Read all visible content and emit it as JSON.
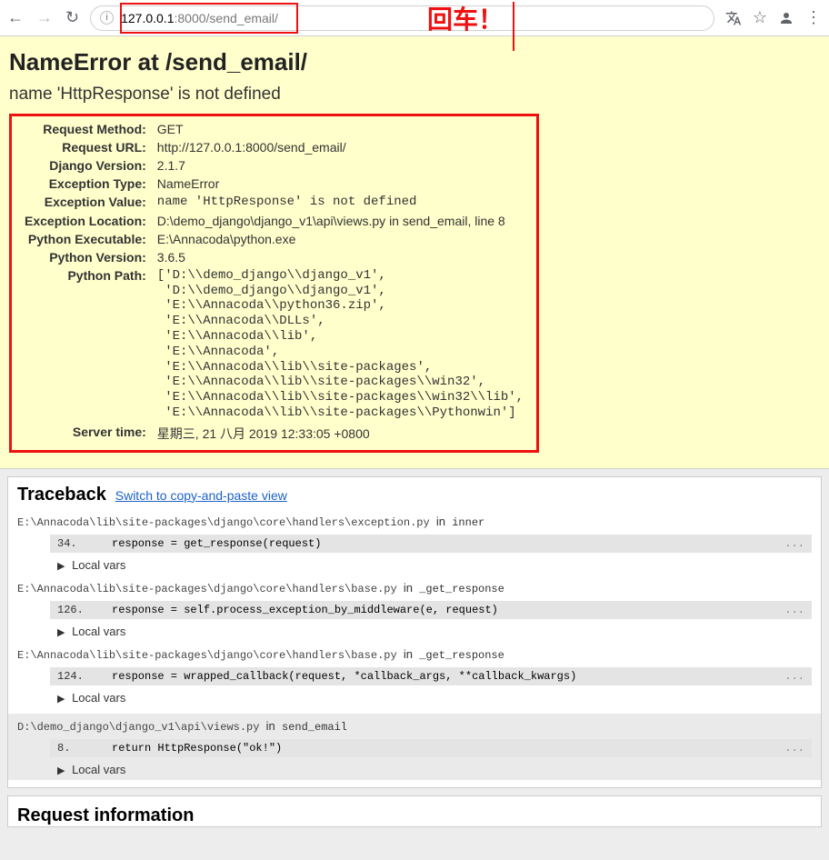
{
  "browser": {
    "url_prefix": "127.0.0.1",
    "url_port": ":8000",
    "url_path": "/send_email/"
  },
  "annotation": "回车！",
  "error": {
    "title": "NameError at /send_email/",
    "subtitle": "name 'HttpResponse' is not defined",
    "rows": {
      "request_method_label": "Request Method:",
      "request_method": "GET",
      "request_url_label": "Request URL:",
      "request_url": "http://127.0.0.1:8000/send_email/",
      "django_version_label": "Django Version:",
      "django_version": "2.1.7",
      "exception_type_label": "Exception Type:",
      "exception_type": "NameError",
      "exception_value_label": "Exception Value:",
      "exception_value": "name 'HttpResponse' is not defined",
      "exception_location_label": "Exception Location:",
      "exception_location": "D:\\demo_django\\django_v1\\api\\views.py in send_email, line 8",
      "python_executable_label": "Python Executable:",
      "python_executable": "E:\\Annacoda\\python.exe",
      "python_version_label": "Python Version:",
      "python_version": "3.6.5",
      "python_path_label": "Python Path:",
      "python_path": "['D:\\\\demo_django\\\\django_v1',\n 'D:\\\\demo_django\\\\django_v1',\n 'E:\\\\Annacoda\\\\python36.zip',\n 'E:\\\\Annacoda\\\\DLLs',\n 'E:\\\\Annacoda\\\\lib',\n 'E:\\\\Annacoda',\n 'E:\\\\Annacoda\\\\lib\\\\site-packages',\n 'E:\\\\Annacoda\\\\lib\\\\site-packages\\\\win32',\n 'E:\\\\Annacoda\\\\lib\\\\site-packages\\\\win32\\\\lib',\n 'E:\\\\Annacoda\\\\lib\\\\site-packages\\\\Pythonwin']",
      "server_time_label": "Server time:",
      "server_time": "星期三, 21 八月 2019 12:33:05 +0800"
    }
  },
  "traceback": {
    "heading": "Traceback",
    "switch": "Switch to copy-and-paste view",
    "local_vars": "Local vars",
    "frames": [
      {
        "file": "E:\\Annacoda\\lib\\site-packages\\django\\core\\handlers\\exception.py",
        "func": "inner",
        "line_no": "34.",
        "code": "            response = get_response(request)",
        "dots": "..."
      },
      {
        "file": "E:\\Annacoda\\lib\\site-packages\\django\\core\\handlers\\base.py",
        "func": "_get_response",
        "line_no": "126.",
        "code": "                response = self.process_exception_by_middleware(e, request)",
        "dots": "..."
      },
      {
        "file": "E:\\Annacoda\\lib\\site-packages\\django\\core\\handlers\\base.py",
        "func": "_get_response",
        "line_no": "124.",
        "code": "                response = wrapped_callback(request, *callback_args, **callback_kwargs)",
        "dots": "..."
      },
      {
        "file": "D:\\demo_django\\django_v1\\api\\views.py",
        "func": "send_email",
        "line_no": "8.",
        "code": "    return HttpResponse(\"ok!\")",
        "dots": "...",
        "highlight": true
      }
    ]
  },
  "request_info_heading": "Request information"
}
